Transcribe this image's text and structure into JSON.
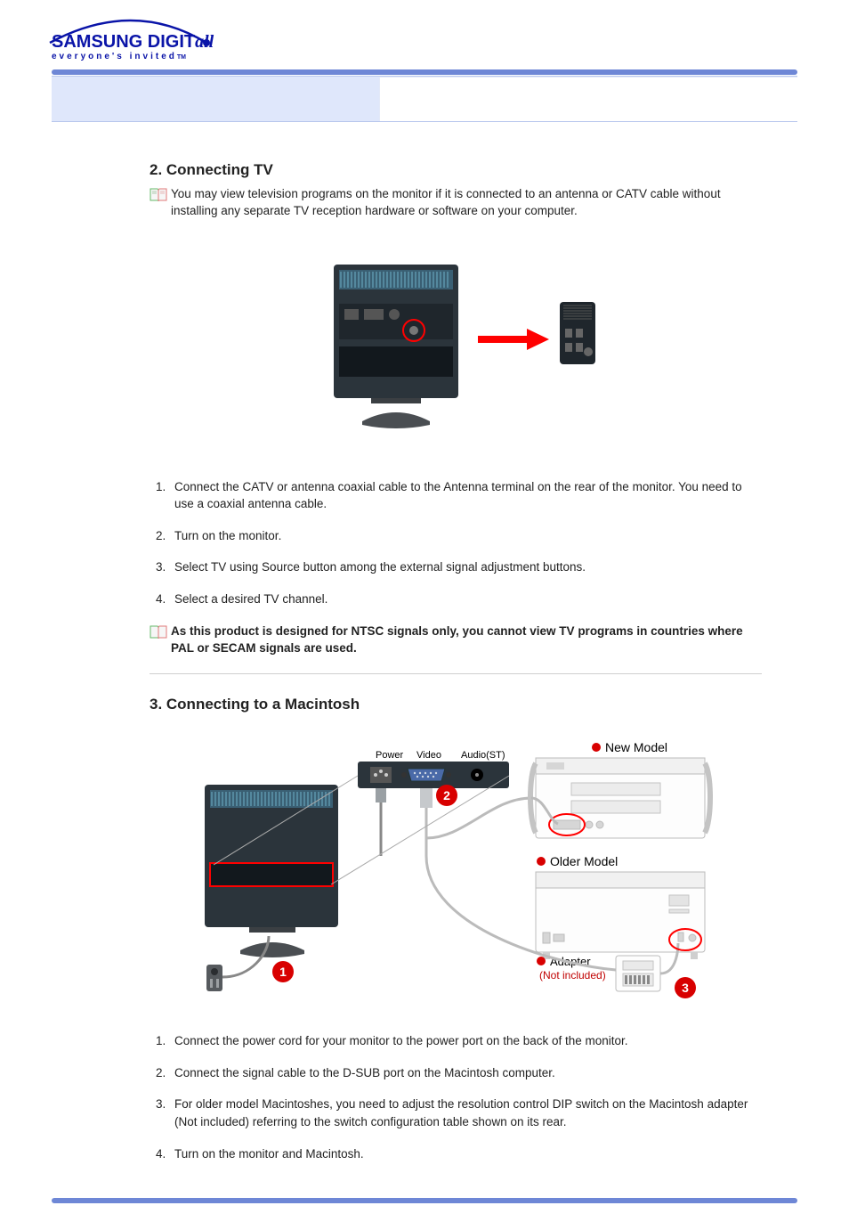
{
  "logo": {
    "brand_prefix": "SAMSUNG DIGIT",
    "brand_italic": "all",
    "tagline": "everyone's invited",
    "tm": "TM"
  },
  "section2": {
    "heading": "2. Connecting TV",
    "intro": "You may view television programs on the monitor if it is connected to an antenna or CATV cable without installing any separate TV reception hardware or software on your computer.",
    "steps": [
      "Connect the CATV or antenna coaxial cable to the Antenna terminal on the rear of the monitor. You need to use a coaxial antenna cable.",
      "Turn on the monitor.",
      "Select TV using Source button among the external signal adjustment buttons.",
      "Select a desired TV channel."
    ],
    "note": "As this product is designed for NTSC signals only, you cannot view TV programs in countries where PAL or SECAM signals are used."
  },
  "section3": {
    "heading": "3. Connecting to a Macintosh",
    "figure": {
      "port_power": "Power",
      "port_video": "Video",
      "port_audio": "Audio(ST)",
      "new_model": "New Model",
      "older_model": "Older Model",
      "adapter": "Adapter",
      "adapter_note": "(Not included)",
      "marker1": "1",
      "marker2": "2",
      "marker3": "3"
    },
    "steps": [
      "Connect the power cord for your monitor to the power port on the back of the monitor.",
      "Connect the signal cable to the D-SUB port on the Macintosh computer.",
      "For older model Macintoshes, you need to adjust the resolution control DIP switch on the Macintosh adapter (Not included) referring to the switch configuration table shown on its rear.",
      "Turn on the monitor and Macintosh."
    ]
  }
}
